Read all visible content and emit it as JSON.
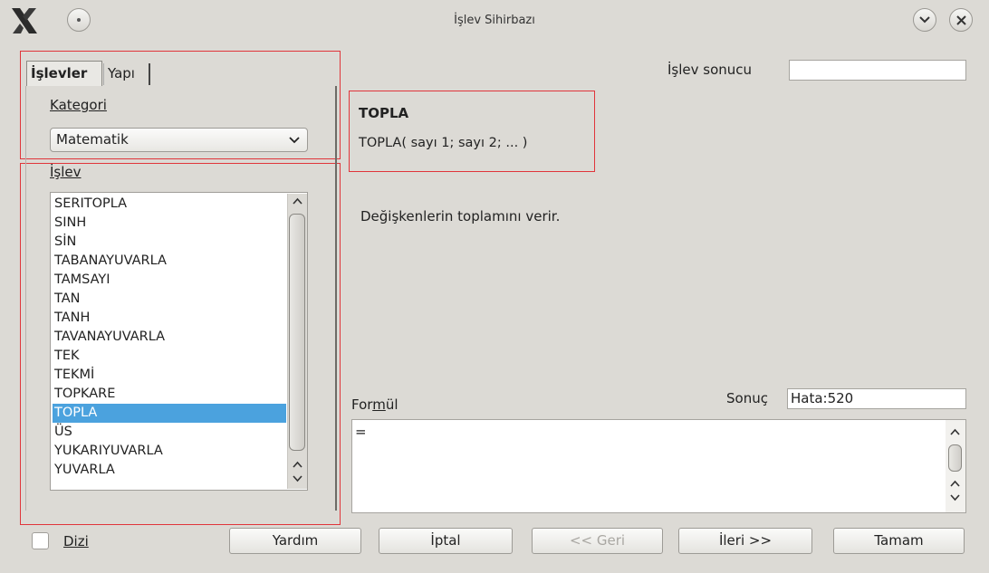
{
  "window": {
    "title": "İşlev Sihirbazı"
  },
  "tabs": [
    {
      "label": "İşlevler"
    },
    {
      "label": "Yapı"
    }
  ],
  "category": {
    "label": "Kategori",
    "value": "Matematik"
  },
  "function_list": {
    "label": "İşlev",
    "items": [
      "SERITOPLA",
      "SINH",
      "SİN",
      "TABANAYUVARLA",
      "TAMSAYI",
      "TAN",
      "TANH",
      "TAVANAYUVARLA",
      "TEK",
      "TEKMİ",
      "TOPKARE",
      "TOPLA",
      "ÜS",
      "YUKARIYUVARLA",
      "YUVARLA"
    ],
    "selected": "TOPLA"
  },
  "function_result": {
    "label": "İşlev sonucu",
    "value": ""
  },
  "function_info": {
    "name": "TOPLA",
    "syntax": "TOPLA( sayı 1; sayı 2; ... )",
    "description": "Değişkenlerin toplamını verir."
  },
  "formula": {
    "label": "Formül",
    "value": "="
  },
  "result": {
    "label": "Sonuç",
    "value": "Hata:520"
  },
  "array_checkbox": {
    "label": "Dizi",
    "checked": false
  },
  "buttons": {
    "help": "Yardım",
    "cancel": "İptal",
    "back": "<< Geri",
    "next": "İleri >>",
    "ok": "Tamam"
  },
  "colors": {
    "selection": "#4ba2de",
    "annotation_frame": "#e0353b",
    "background": "#dcdad5"
  }
}
